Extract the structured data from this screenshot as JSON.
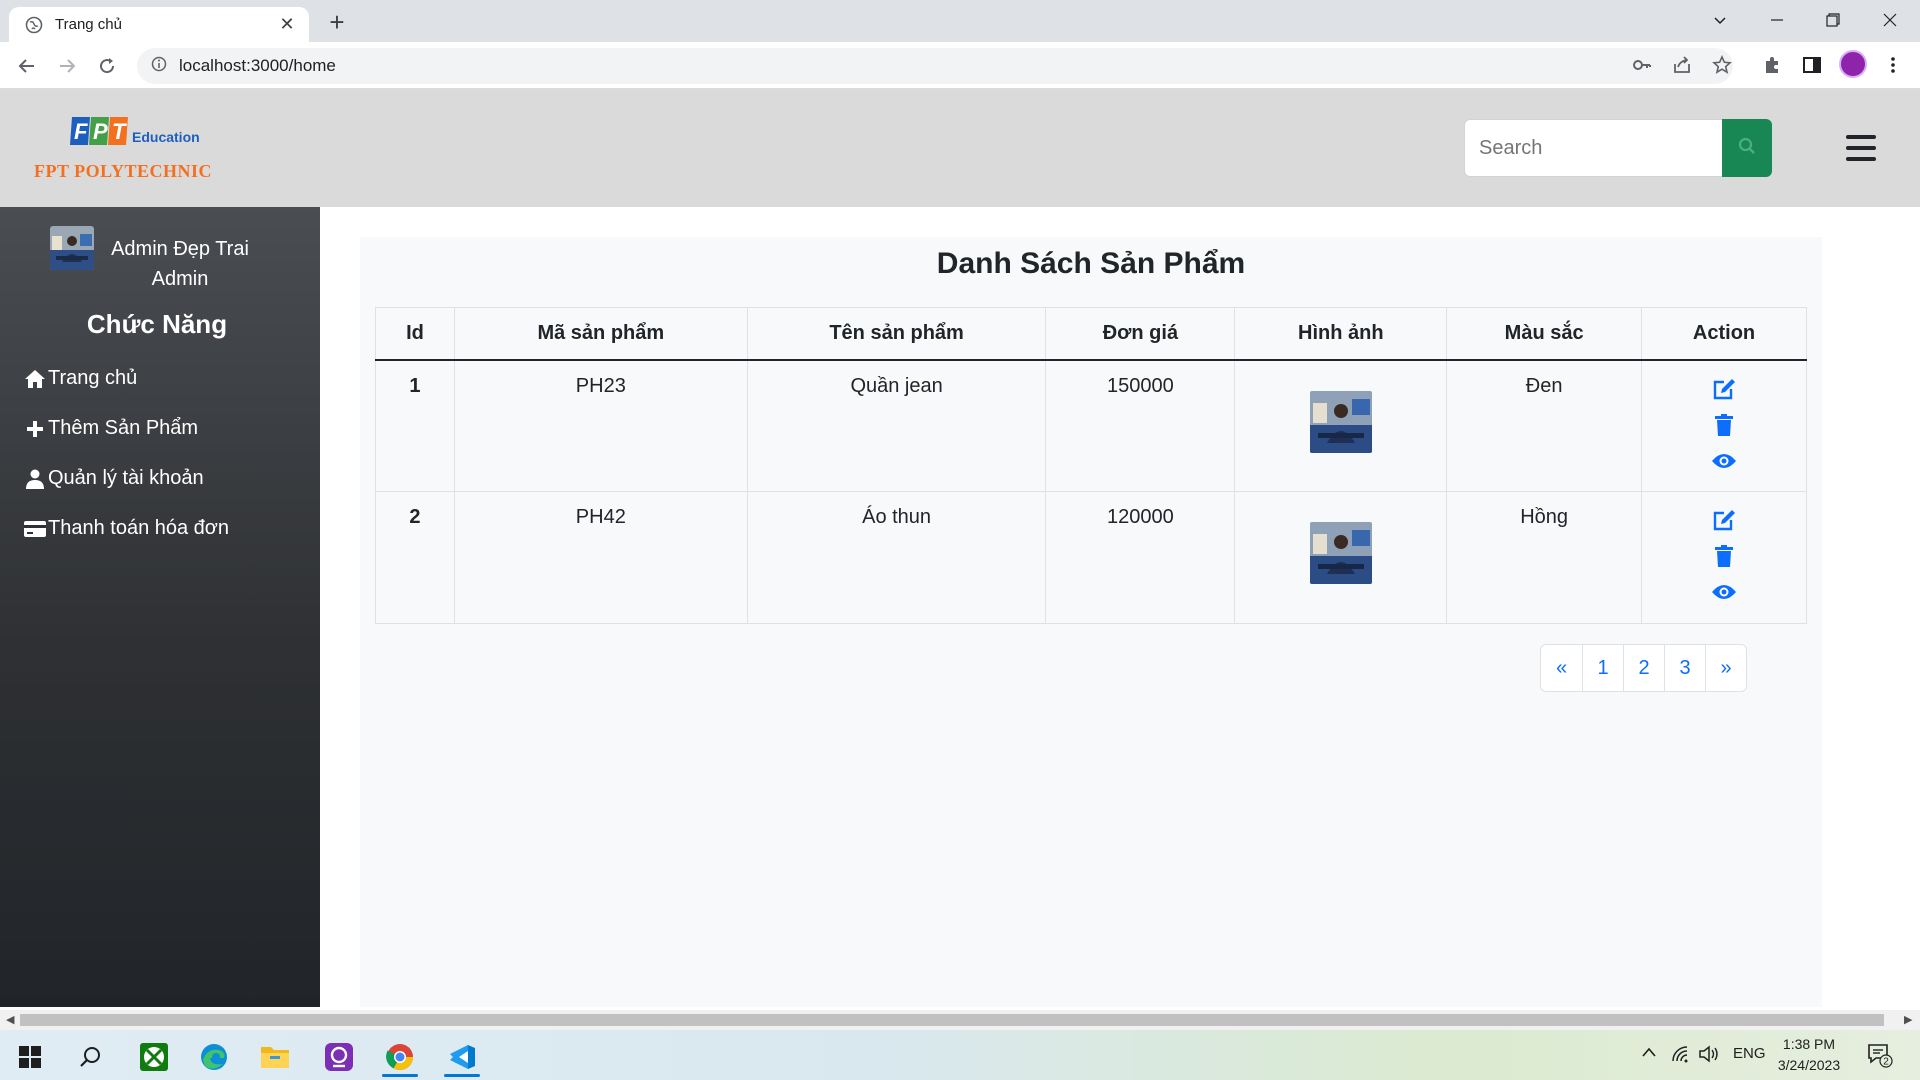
{
  "browser": {
    "tab_title": "Trang chủ",
    "url": "localhost:3000/home"
  },
  "header": {
    "logo_education": "Education",
    "logo_name": "FPT POLYTECHNIC",
    "search_placeholder": "Search"
  },
  "sidebar": {
    "user_name": "Admin Đẹp Trai",
    "user_role": "Admin",
    "section_title": "Chức Năng",
    "items": [
      {
        "label": "Trang chủ",
        "icon": "home-icon"
      },
      {
        "label": "Thêm Sản Phẩm",
        "icon": "plus-icon"
      },
      {
        "label": "Quản lý tài khoản",
        "icon": "user-icon"
      },
      {
        "label": "Thanh toán hóa đơn",
        "icon": "credit-card-icon"
      }
    ]
  },
  "main": {
    "title": "Danh Sách Sản Phẩm",
    "columns": [
      "Id",
      "Mã sản phẩm",
      "Tên sản phẩm",
      "Đơn giá",
      "Hình ảnh",
      "Màu sắc",
      "Action"
    ],
    "rows": [
      {
        "id": "1",
        "code": "PH23",
        "name": "Quần jean",
        "price": "150000",
        "color": "Đen"
      },
      {
        "id": "2",
        "code": "PH42",
        "name": "Áo thun",
        "price": "120000",
        "color": "Hồng"
      }
    ],
    "pagination": [
      "«",
      "1",
      "2",
      "3",
      "»"
    ]
  },
  "taskbar": {
    "language": "ENG",
    "time": "1:38 PM",
    "date": "3/24/2023",
    "notifications": "2"
  },
  "colors": {
    "accent": "#0d6efd",
    "search_button": "#198754",
    "logo_orange": "#f37021"
  }
}
